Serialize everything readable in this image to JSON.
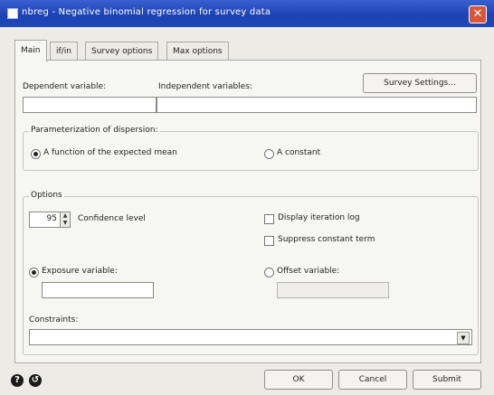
{
  "window": {
    "title": "nbreg  - Negative binomial regression for survey data"
  },
  "tabs": [
    "Main",
    "if/in",
    "Survey options",
    "Max options"
  ],
  "main": {
    "dependent_label": "Dependent variable:",
    "independent_label": "Independent variables:",
    "survey_settings_label": "Survey Settings...",
    "parameterization": {
      "title": "Parameterization of dispersion:",
      "opt_mean": "A function of the expected mean",
      "opt_constant": "A constant"
    },
    "options": {
      "title": "Options",
      "confidence_value": "95",
      "confidence_label": "Confidence level",
      "display_iteration": "Display iteration log",
      "suppress_constant": "Suppress constant term",
      "exposure_label": "Exposure variable:",
      "offset_label": "Offset variable:",
      "constraints_label": "Constraints:"
    }
  },
  "footer": {
    "ok": "OK",
    "cancel": "Cancel",
    "submit": "Submit"
  }
}
